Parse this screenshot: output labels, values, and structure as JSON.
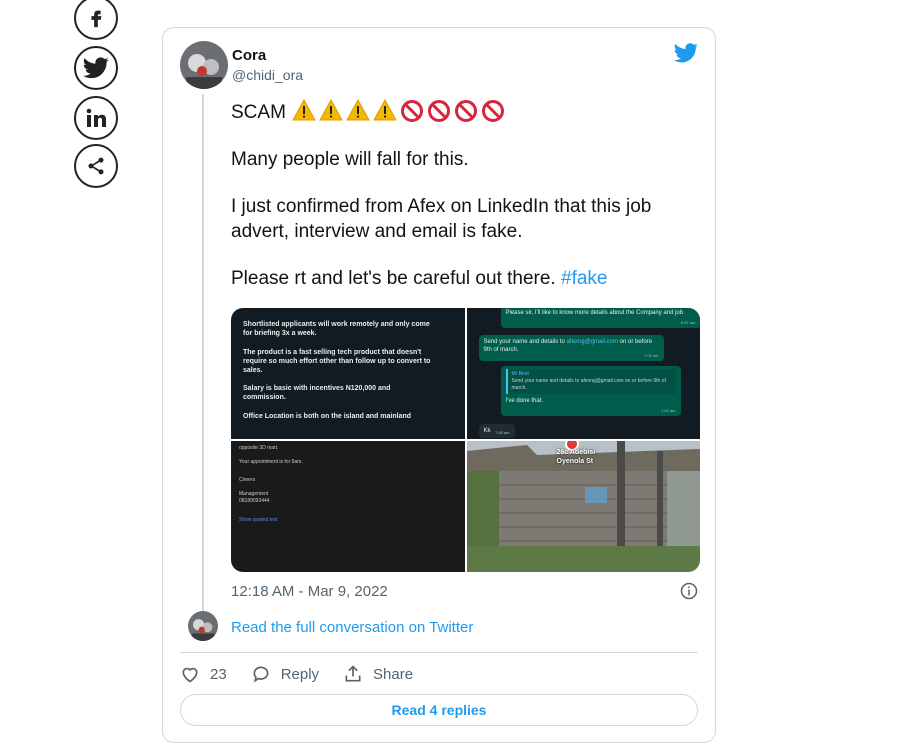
{
  "share_icons": [
    "facebook-icon",
    "twitter-icon",
    "linkedin-icon",
    "share-icon"
  ],
  "tweet": {
    "author_name": "Cora",
    "author_handle": "@chidi_ora",
    "line1": "SCAM",
    "line2": "Many people will fall for this.",
    "line3": "I just confirmed from Afex on LinkedIn that this job advert, interview and email is fake.",
    "line4_text": "Please rt and let's be careful out there. ",
    "hashtag": "#fake",
    "timestamp": "12:18 AM - Mar 9, 2022",
    "read_conversation": "Read the full conversation on Twitter",
    "like_count": "23",
    "reply_label": "Reply",
    "share_label": "Share",
    "read_replies": "Read 4 replies"
  },
  "media": {
    "img1": [
      "Shortlisted applicants will work remotely and only come for briefing 3x a week.",
      "The product is a fast selling tech product that doesn't require so much effort other than follow up to convert to sales.",
      "Salary is basic with incentives N120,000 and commission.",
      "Office Location is both on the island and mainland"
    ],
    "img2": {
      "msg1": "Please sir, I'll like to know more details about the Company and job",
      "msg1_time": "6:57 am",
      "msg2_pre": "Send your name and details to ",
      "msg2_link": "afexng@gmail.com",
      "msg2_post": " on or before 9th of march.",
      "msg2_time": "7:02 am",
      "quote_name": "Mr Best",
      "quote_text": "Send your name and details to afexng@gmail.com on or before 9th of march.",
      "msg3": "I've done that.",
      "msg3_time": "7:52 am",
      "msg4": "Kk",
      "msg4_time": "7:55 am"
    },
    "img3": {
      "line1": "opposite 3D mart.",
      "line2": "Your appointment is for 9am.",
      "line3": "Cheers",
      "line4": "Management",
      "line5": "08189093444",
      "line6": "Show quoted text"
    },
    "img4": {
      "place1": "26c Adebisi",
      "place2": "Oyenola St"
    }
  },
  "colors": {
    "twitter_blue": "#1d9bf0",
    "text": "#0f1419",
    "muted": "#536471",
    "border": "#cfd9de"
  }
}
